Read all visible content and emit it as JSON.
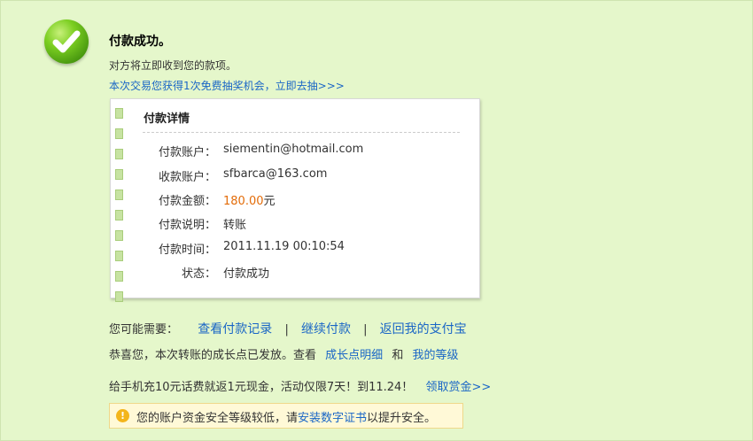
{
  "header": {
    "title": "付款成功。",
    "subtitle": "对方将立即收到您的款项。",
    "lottery_link": "本次交易您获得1次免费抽奖机会，立即去抽>>>"
  },
  "details": {
    "title": "付款详情",
    "rows": [
      {
        "label": "付款账户：",
        "value": "siementin@hotmail.com"
      },
      {
        "label": "收款账户：",
        "value": "sfbarca@163.com"
      },
      {
        "label": "付款金额：",
        "amount": "180.00",
        "unit": "元"
      },
      {
        "label": "付款说明：",
        "value": "转账"
      },
      {
        "label": "付款时间：",
        "value": "2011.11.19 00:10:54"
      },
      {
        "label": "状态：",
        "value": "付款成功"
      }
    ]
  },
  "actions": {
    "prompt": "您可能需要：",
    "view_records": "查看付款记录",
    "continue_pay": "继续付款",
    "back_home": "返回我的支付宝",
    "separator": "|"
  },
  "growth": {
    "text": "恭喜您，本次转账的成长点已发放。查看",
    "link_detail": "成长点明细",
    "and": "和",
    "link_level": "我的等级"
  },
  "promo": {
    "text": "给手机充10元话费就返1元现金，活动仅限7天！到11.24！",
    "link": "领取赏金>>"
  },
  "warning": {
    "icon": "!",
    "text_before": "您的账户资金安全等级较低，请",
    "link": "安装数字证书",
    "text_after": "以提升安全。"
  }
}
